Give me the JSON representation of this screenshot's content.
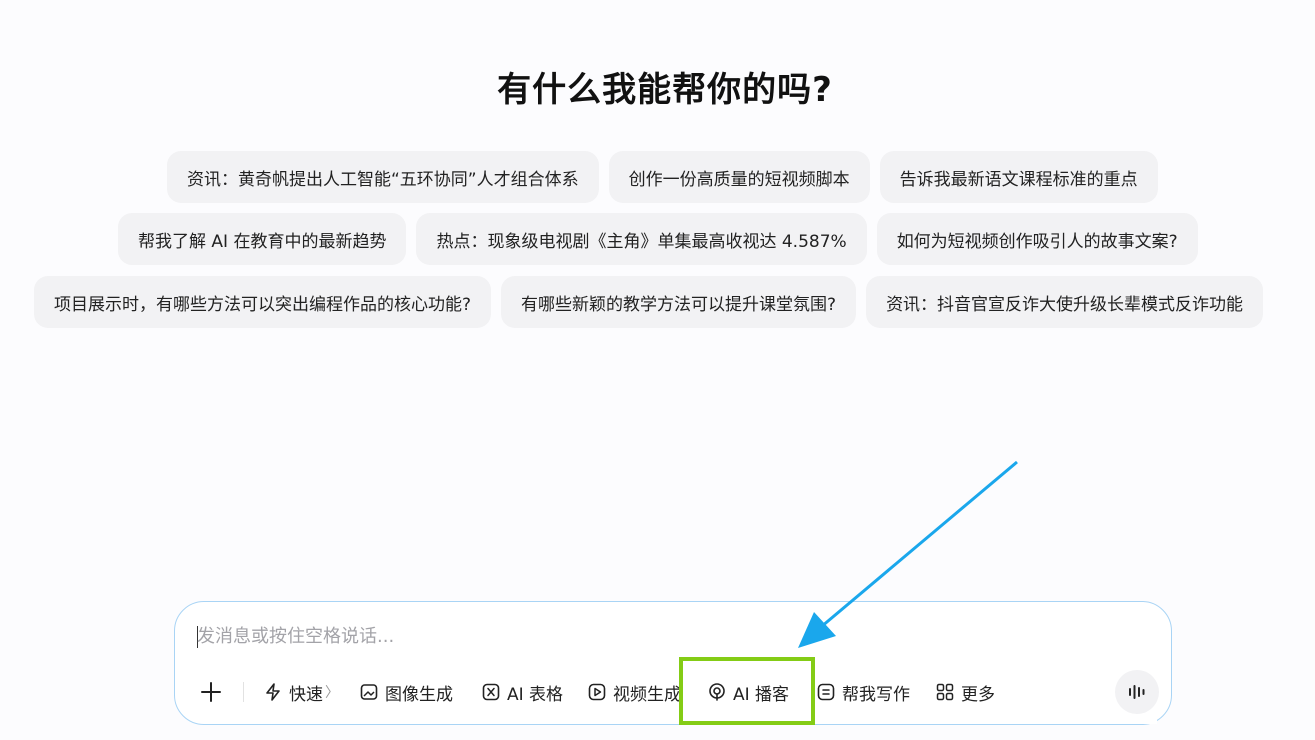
{
  "title": "有什么我能帮你的吗?",
  "suggestions": {
    "row1": [
      "资讯：黄奇帆提出人工智能“五环协同”人才组合体系",
      "创作一份高质量的短视频脚本",
      "告诉我最新语文课程标准的重点"
    ],
    "row2": [
      "帮我了解 AI 在教育中的最新趋势",
      "热点：现象级电视剧《主角》单集最高收视达 4.587%",
      "如何为短视频创作吸引人的故事文案?"
    ],
    "row3": [
      "项目展示时，有哪些方法可以突出编程作品的核心功能?",
      "有哪些新颖的教学方法可以提升课堂氛围?",
      "资讯：抖音官宣反诈大使升级长辈模式反诈功能"
    ]
  },
  "composer": {
    "placeholder": "发消息或按住空格说话..."
  },
  "toolbar": {
    "quick": "快速",
    "quick_chevron": "〉",
    "image": "图像生成",
    "sheet": "AI 表格",
    "video": "视频生成",
    "podcast": "AI 播客",
    "write": "帮我写作",
    "more": "更多"
  },
  "colors": {
    "highlight": "#84cc16",
    "arrow": "#1aa7ec",
    "composer_border": "#a9d4f5"
  }
}
